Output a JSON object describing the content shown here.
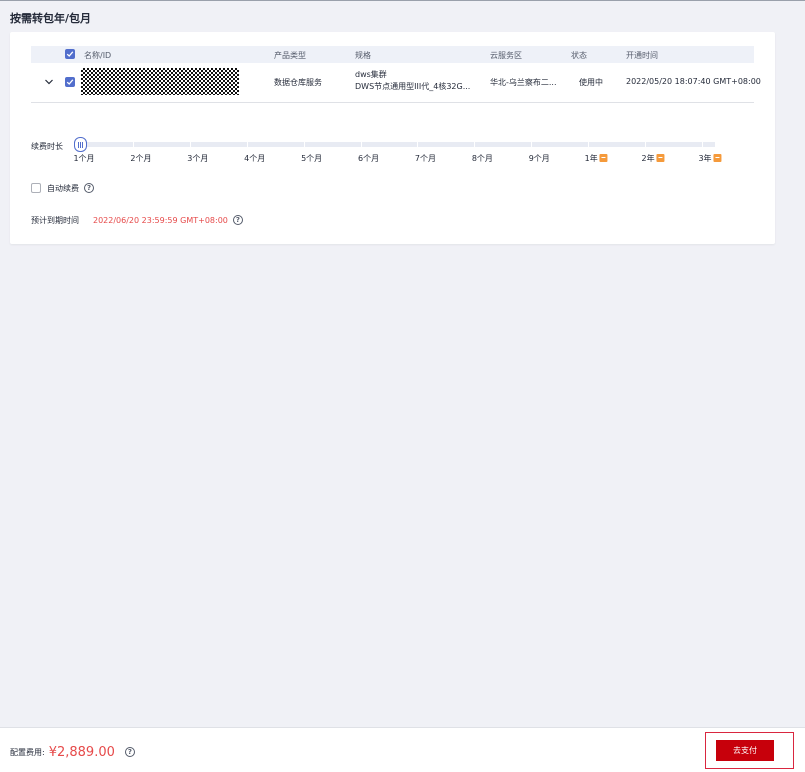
{
  "page": {
    "title": "按需转包年/包月"
  },
  "table": {
    "headers": [
      "名称/ID",
      "产品类型",
      "规格",
      "云服务区",
      "状态",
      "开通时间"
    ],
    "row": {
      "product_type": "数据仓库服务",
      "spec_line1": "dws集群",
      "spec_line2": "DWS节点通用型III代_4核32G...",
      "region": "华北-乌兰察布二...",
      "status": "使用中",
      "created": "2022/05/20 18:07:40 GMT+08:00"
    }
  },
  "renewal": {
    "label": "续费时长",
    "selected": "1个月",
    "ticks": [
      "1个月",
      "2个月",
      "3个月",
      "4个月",
      "5个月",
      "6个月",
      "7个月",
      "8个月",
      "9个月",
      "1年",
      "2年",
      "3年"
    ],
    "discount_ticks": [
      "1年",
      "2年",
      "3年"
    ]
  },
  "auto_renew": {
    "label": "自动续费",
    "checked": false
  },
  "expiry": {
    "label": "预计到期时间",
    "value": "2022/06/20 23:59:59 GMT+08:00"
  },
  "footer": {
    "fee_label": "配置费用:",
    "fee_value": "¥2,889.00",
    "pay_button": "去支付"
  },
  "colors": {
    "accent": "#526ecc",
    "price_red": "#e64a4a",
    "pay_red": "#c7000b",
    "discount_orange": "#f59a3b"
  },
  "icons": [
    "chevron-down-icon",
    "checkbox-checked-icon",
    "help-circle-icon",
    "slider-grip-icon",
    "discount-badge-icon"
  ]
}
